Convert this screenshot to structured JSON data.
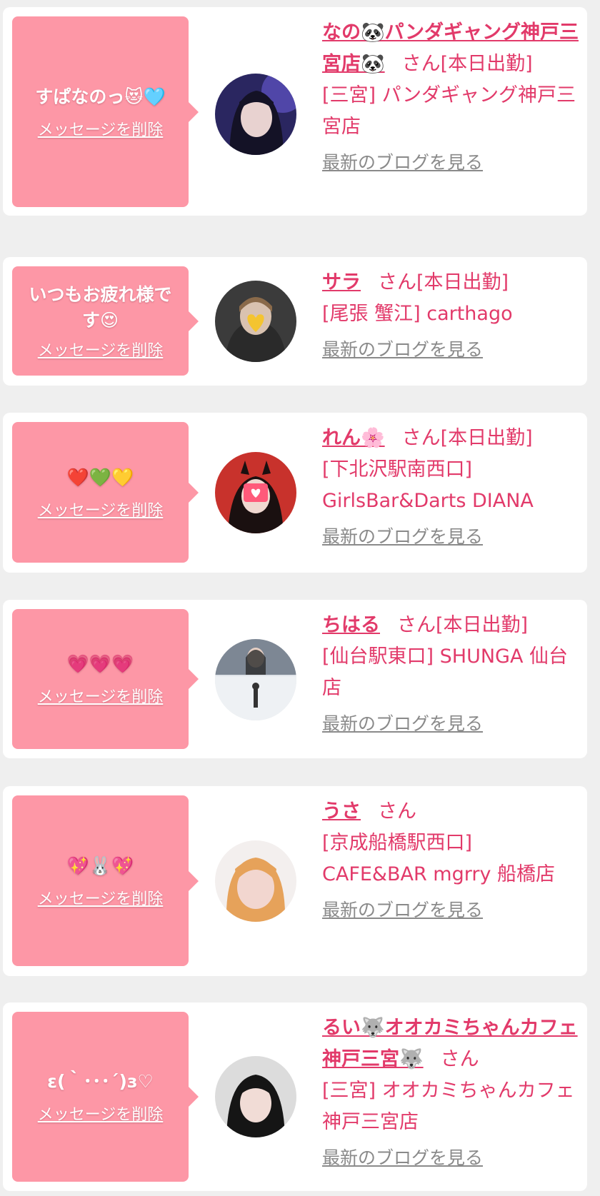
{
  "delete_label": "メッセージを削除",
  "blog_label": "最新のブログを見る",
  "honorific": "さん",
  "colors": {
    "bubble": "#fd97a6",
    "accent": "#e23a6a",
    "link_gray": "#8a8a8a",
    "background": "#efefef"
  },
  "messages": [
    {
      "text": "すぱなのっ😻🩵",
      "name": "なの🐼パンダギャング神戸三宮店🐼",
      "status": "[本日出勤]",
      "shop": "[三宮] パンダギャング神戸三宮店"
    },
    {
      "text": "いつもお疲れ様です😍",
      "name": "サラ",
      "status": "[本日出勤]",
      "shop": "[尾張 蟹江] carthago"
    },
    {
      "text": "❤️💚💛",
      "name": "れん🌸",
      "status": "[本日出勤]",
      "shop": "[下北沢駅南西口] GirlsBar&Darts DIANA"
    },
    {
      "text": "💗💗💗",
      "name": "ちはる",
      "status": "[本日出勤]",
      "shop": "[仙台駅東口] SHUNGA 仙台店"
    },
    {
      "text": "💖🐰💖",
      "name": "うさ",
      "status": "",
      "shop": "[京成船橋駅西口] CAFE&BAR mgrry 船橋店"
    },
    {
      "text": "ε(｀･･･´)з♡",
      "name": "るい🐺オオカミちゃんカフェ神戸三宮🐺",
      "status": "",
      "shop": "[三宮] オオカミちゃんカフェ神戸三宮店"
    }
  ]
}
